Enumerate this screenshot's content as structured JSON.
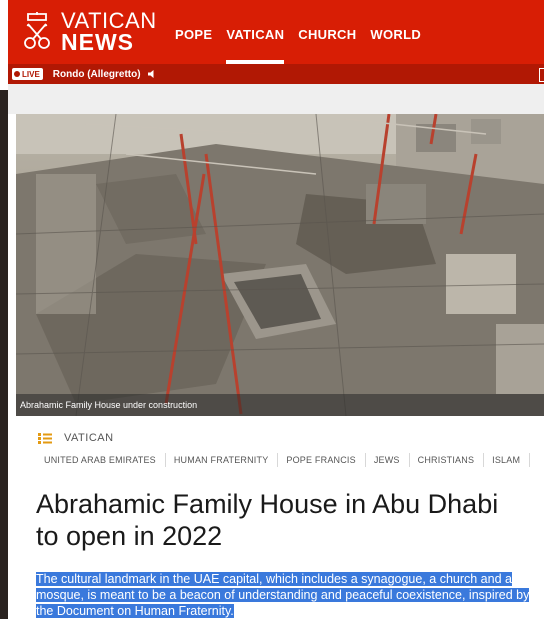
{
  "brand": {
    "line1": "VATICAN",
    "line2": "NEWS"
  },
  "nav": {
    "items": [
      {
        "label": "POPE"
      },
      {
        "label": "VATICAN"
      },
      {
        "label": "CHURCH"
      },
      {
        "label": "WORLD"
      }
    ],
    "active": "VATICAN"
  },
  "live": {
    "badge": "LIVE",
    "title": "Rondo (Allegretto)"
  },
  "hero": {
    "caption": "Abrahamic Family House under construction"
  },
  "article": {
    "section": "VATICAN",
    "tags": [
      "UNITED ARAB EMIRATES",
      "HUMAN FRATERNITY",
      "POPE FRANCIS",
      "JEWS",
      "CHRISTIANS",
      "ISLAM"
    ],
    "title": "Abrahamic Family House in Abu Dhabi to open in 2022",
    "lead": "The cultural landmark in the UAE capital, which includes a synagogue, a church and a mosque, is meant to be a beacon of understanding and peaceful coexistence, inspired by the Document on Human Fraternity."
  },
  "colors": {
    "brand_red": "#d81e05",
    "live_bar": "#b11804",
    "selection": "#3a79dc"
  }
}
